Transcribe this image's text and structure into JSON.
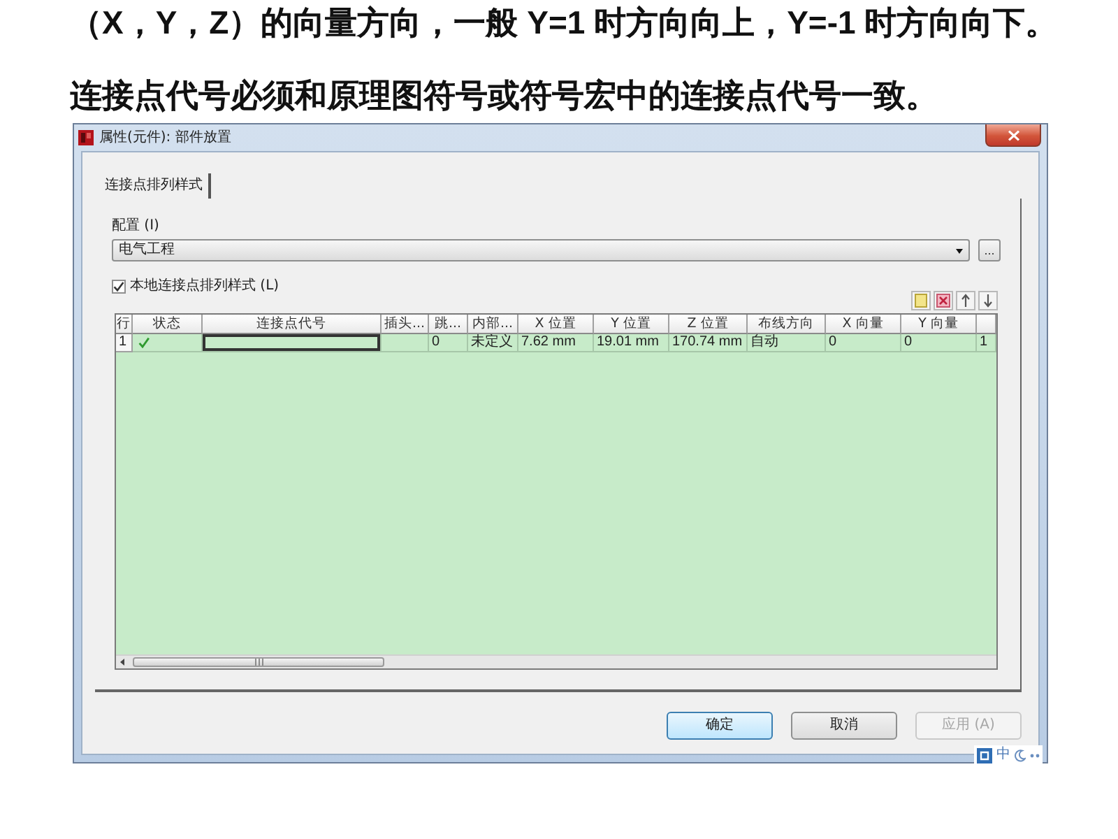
{
  "document": {
    "paragraphs": [
      "（X，Y，Z）的向量方向，一般 Y=1 时方向向上，Y=-1 时方向向下。",
      "连接点代号必须和原理图符号或符号宏中的连接点代号一致。"
    ]
  },
  "dialog": {
    "title": "属性(元件): 部件放置",
    "tabs": [
      {
        "label": "连接点排列样式",
        "selected": true
      }
    ],
    "configuration": {
      "label": "配置 (I)",
      "value": "电气工程",
      "browse_button": "..."
    },
    "local_style": {
      "label": "本地连接点排列样式 (L)",
      "checked": true
    },
    "table": {
      "columns": [
        "行",
        "状态",
        "连接点代号",
        "插头...",
        "跳...",
        "内部...",
        "X 位置",
        "Y 位置",
        "Z 位置",
        "布线方向",
        "X 向量",
        "Y 向量"
      ],
      "rows": [
        {
          "cells": [
            {
              "kind": "row_header",
              "text": "1",
              "selected": false
            },
            {
              "kind": "status",
              "ok": true,
              "selected": false
            },
            {
              "kind": "text",
              "selected": true
            },
            {
              "kind": "text",
              "selected": false
            },
            {
              "kind": "text",
              "text": "0",
              "selected": false
            },
            {
              "kind": "text",
              "text": "未定义",
              "selected": false
            },
            {
              "kind": "text",
              "text": "7.62 mm",
              "selected": false
            },
            {
              "kind": "text",
              "text": "19.01 mm",
              "selected": false
            },
            {
              "kind": "text",
              "text": "170.74 mm",
              "selected": false
            },
            {
              "kind": "text",
              "text": "自动",
              "selected": false
            },
            {
              "kind": "text",
              "text": "0",
              "selected": false
            },
            {
              "kind": "text",
              "text": "0",
              "selected": false
            },
            {
              "kind": "text",
              "text": "1",
              "selected": false
            }
          ]
        }
      ]
    },
    "buttons": [
      {
        "label": "确定",
        "default": true,
        "disabled": false
      },
      {
        "label": "取消",
        "default": false,
        "disabled": false
      },
      {
        "label": "应用 (A)",
        "default": false,
        "disabled": true
      }
    ]
  },
  "ime_bar": {
    "label": "中"
  }
}
